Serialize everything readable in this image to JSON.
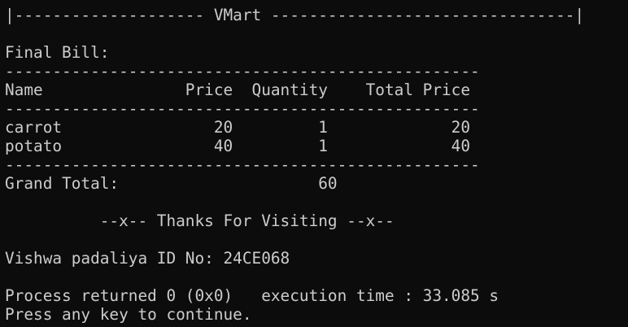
{
  "console": {
    "lines": [
      "|-------------------- VMart --------------------------------|",
      "",
      "Final Bill:",
      "--------------------------------------------------",
      "Name               Price  Quantity    Total Price",
      "--------------------------------------------------",
      "carrot                20         1             20",
      "potato                40         1             40",
      "--------------------------------------------------",
      "Grand Total:                     60",
      "",
      "          --x-- Thanks For Visiting --x--",
      "",
      "Vishwa padaliya ID No: 24CE068",
      "",
      "Process returned 0 (0x0)   execution time : 33.085 s",
      "Press any key to continue."
    ]
  }
}
